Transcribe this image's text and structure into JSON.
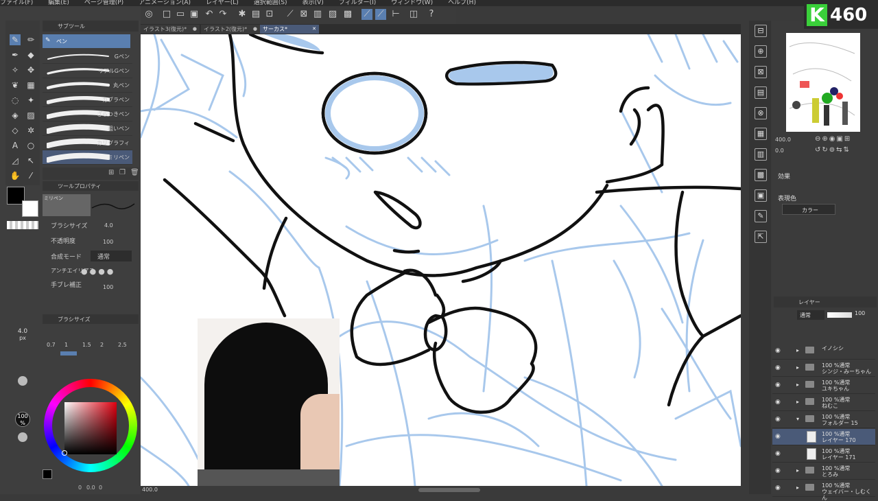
{
  "menu": [
    "ファイル(F)",
    "編集(E)",
    "ページ管理(P)",
    "アニメーション(A)",
    "レイヤー(L)",
    "選択範囲(S)",
    "表示(V)",
    "フィルター(I)",
    "ウィンドウ(W)",
    "ヘルプ(H)"
  ],
  "tabs": [
    {
      "label": "イラスト3(復元)*"
    },
    {
      "label": "イラスト2(復元)*"
    },
    {
      "label": "サーカス*"
    }
  ],
  "logo": {
    "letter": "K",
    "number": "460"
  },
  "subtool": {
    "header": "サブツール",
    "group": "ペン",
    "items": [
      "Gペン",
      "リアルGペン",
      "丸ペン",
      "カブラペン",
      "ざらつきペン",
      "粗いペン",
      "カリグラフィ",
      "ミリペン"
    ]
  },
  "toolprops": {
    "header": "ツールプロパティ",
    "preset": "ミリペン",
    "brush_size_label": "ブラシサイズ",
    "brush_size": "4.0",
    "opacity_label": "不透明度",
    "opacity": "100",
    "blend_label": "合成モード",
    "blend": "通常",
    "aa_label": "アンチエイリアス",
    "stab_label": "手ブレ補正",
    "stab": "100"
  },
  "brushsize": {
    "header": "ブラシサイズ",
    "value": "4.0",
    "unit": "px",
    "sizes": [
      "0.7",
      "1",
      "1.5",
      "2",
      "2.5"
    ]
  },
  "opacity_side": {
    "value": "100",
    "unit": "%"
  },
  "canvas_status": {
    "zoom": "400.0"
  },
  "bottom_status": [
    "0",
    "0.0",
    "0"
  ],
  "navigator": {
    "header": "ナビゲーター",
    "zoom": "400.0",
    "angle": "0.0"
  },
  "effect": {
    "header": "効果",
    "color_label": "表現色",
    "color_value": "カラー"
  },
  "layers": {
    "header": "レイヤー",
    "blend": "通常",
    "opacity": "100",
    "rows": [
      {
        "line1": "イノシシ",
        "line2": "",
        "type": "folder"
      },
      {
        "line1": "100 %通常",
        "line2": "シンジ・みーちゃん",
        "type": "folder"
      },
      {
        "line1": "100 %通常",
        "line2": "ユキちゃん",
        "type": "folder"
      },
      {
        "line1": "100 %通常",
        "line2": "ねむこ",
        "type": "folder"
      },
      {
        "line1": "100 %通常",
        "line2": "フォルダー 15",
        "type": "folder-open"
      },
      {
        "line1": "100 %通常",
        "line2": "レイヤー 170",
        "type": "layer-active"
      },
      {
        "line1": "100 %通常",
        "line2": "レイヤー 171",
        "type": "layer"
      },
      {
        "line1": "100 %通常",
        "line2": "とろみ",
        "type": "folder"
      },
      {
        "line1": "100 %通常",
        "line2": "ウェイバー・しむくん",
        "type": "folder"
      }
    ]
  },
  "colors": {
    "sketch": "#a8c8ec",
    "ink": "#111111",
    "accent": "#5a7fb0",
    "panel": "#3e3e3e"
  }
}
